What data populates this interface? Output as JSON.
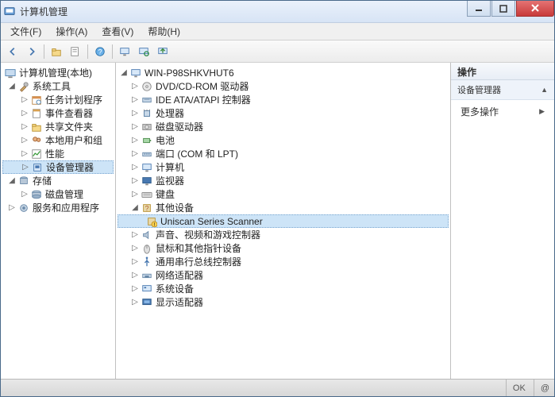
{
  "window": {
    "title": "计算机管理"
  },
  "menubar": [
    {
      "label": "文件(F)"
    },
    {
      "label": "操作(A)"
    },
    {
      "label": "查看(V)"
    },
    {
      "label": "帮助(H)"
    }
  ],
  "toolbar_icons": [
    "back",
    "forward",
    "up",
    "refresh",
    "export",
    "help",
    "monitor",
    "scan",
    "update"
  ],
  "left_tree": {
    "root": "计算机管理(本地)",
    "groups": [
      {
        "label": "系统工具",
        "expanded": true,
        "children": [
          {
            "label": "任务计划程序",
            "icon": "sched"
          },
          {
            "label": "事件查看器",
            "icon": "event"
          },
          {
            "label": "共享文件夹",
            "icon": "share"
          },
          {
            "label": "本地用户和组",
            "icon": "users"
          },
          {
            "label": "性能",
            "icon": "perf"
          },
          {
            "label": "设备管理器",
            "icon": "devmgr",
            "selected": true
          }
        ]
      },
      {
        "label": "存储",
        "expanded": true,
        "children": [
          {
            "label": "磁盘管理",
            "icon": "disk"
          }
        ]
      },
      {
        "label": "服务和应用程序",
        "expanded": false,
        "children": []
      }
    ]
  },
  "mid_tree": {
    "root": "WIN-P98SHKVHUT6",
    "categories": [
      {
        "label": "DVD/CD-ROM 驱动器",
        "icon": "dvd"
      },
      {
        "label": "IDE ATA/ATAPI 控制器",
        "icon": "ide"
      },
      {
        "label": "处理器",
        "icon": "cpu"
      },
      {
        "label": "磁盘驱动器",
        "icon": "diskdrv"
      },
      {
        "label": "电池",
        "icon": "battery"
      },
      {
        "label": "端口 (COM 和 LPT)",
        "icon": "port"
      },
      {
        "label": "计算机",
        "icon": "computer"
      },
      {
        "label": "监视器",
        "icon": "monitor"
      },
      {
        "label": "键盘",
        "icon": "keyboard"
      },
      {
        "label": "其他设备",
        "icon": "other",
        "expanded": true,
        "children": [
          {
            "label": "Uniscan Series Scanner",
            "icon": "unknown",
            "selected": true
          }
        ]
      },
      {
        "label": "声音、视频和游戏控制器",
        "icon": "sound"
      },
      {
        "label": "鼠标和其他指针设备",
        "icon": "mouse"
      },
      {
        "label": "通用串行总线控制器",
        "icon": "usb"
      },
      {
        "label": "网络适配器",
        "icon": "network"
      },
      {
        "label": "系统设备",
        "icon": "system"
      },
      {
        "label": "显示适配器",
        "icon": "display"
      }
    ]
  },
  "right_pane": {
    "header": "操作",
    "section": "设备管理器",
    "more": "更多操作"
  },
  "statusbar": {
    "left": "OK",
    "right": "@"
  }
}
